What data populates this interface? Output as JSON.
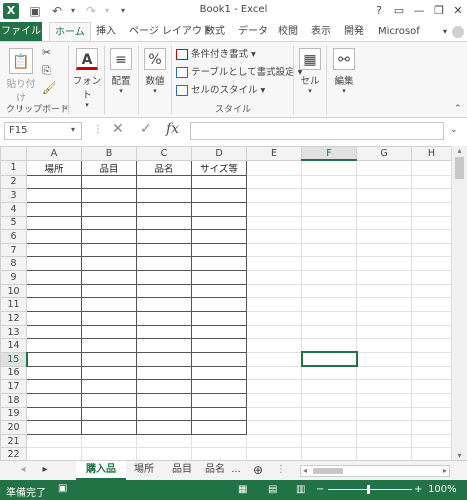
{
  "window": {
    "title": "Book1 - Excel",
    "help": "?",
    "minimize": "—",
    "restore": "❐",
    "close": "✕"
  },
  "quick_access": {
    "save": "💾",
    "undo": "↶",
    "redo": "↷",
    "customize": "▾"
  },
  "tabs": [
    "ファイル",
    "ホーム",
    "挿入",
    "ページ レイアウト",
    "数式",
    "データ",
    "校閲",
    "表示",
    "開発",
    "Microsof"
  ],
  "ribbon": {
    "clipboard": {
      "paste": "貼り付け",
      "label": "クリップボード"
    },
    "font": "フォント",
    "alignment": "配置",
    "number": "数値",
    "styles": {
      "conditional": "条件付き書式",
      "table": "テーブルとして書式設定",
      "cell_styles": "セルのスタイル",
      "label": "スタイル"
    },
    "cells": "セル",
    "editing": "編集"
  },
  "formula_bar": {
    "name_box": "F15",
    "fx": "fx",
    "value": ""
  },
  "columns": [
    "A",
    "B",
    "C",
    "D",
    "E",
    "F",
    "G",
    "H"
  ],
  "rows": [
    "1",
    "2",
    "3",
    "4",
    "5",
    "6",
    "7",
    "8",
    "9",
    "10",
    "11",
    "12",
    "13",
    "14",
    "15",
    "16",
    "17",
    "18",
    "19",
    "20",
    "21",
    "22"
  ],
  "table_headers": [
    "場所",
    "品目",
    "品名",
    "サイズ等"
  ],
  "active_cell": "F15",
  "sheet_tabs": [
    "購入品",
    "場所",
    "品目",
    "品名"
  ],
  "sheet_more": "...",
  "status": {
    "text": "準備完了",
    "zoom": "100%"
  },
  "colors": {
    "accent": "#217346"
  }
}
